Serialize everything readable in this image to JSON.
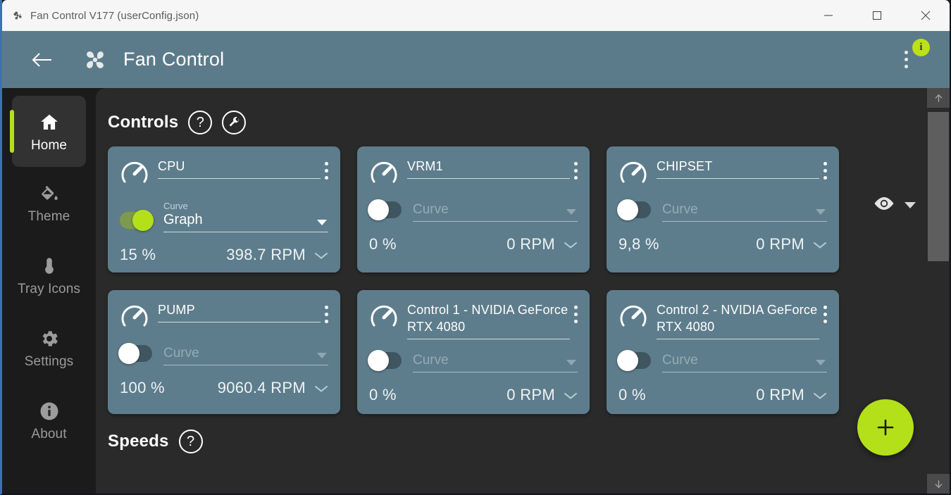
{
  "window": {
    "title": "Fan Control V177 (userConfig.json)",
    "icon": "fan-icon",
    "buttons": [
      {
        "name": "minimize",
        "label": "—"
      },
      {
        "name": "maximize",
        "label": "▢"
      },
      {
        "name": "close",
        "label": "✕"
      }
    ]
  },
  "appbar": {
    "back_label": "back-arrow",
    "logo": "fan-icon",
    "title": "Fan Control",
    "menu": "kebab-menu",
    "badge": "i"
  },
  "sidebar": {
    "items": [
      {
        "label": "Home",
        "icon": "home-icon",
        "active": true
      },
      {
        "label": "Theme",
        "icon": "paint-bucket-icon",
        "active": false
      },
      {
        "label": "Tray\nIcons",
        "icon": "thermometer-icon",
        "active": false
      },
      {
        "label": "Settings",
        "icon": "gear-icon",
        "active": false
      },
      {
        "label": "About",
        "icon": "info-circle-icon",
        "active": false
      }
    ]
  },
  "main": {
    "controls_section": {
      "title": "Controls",
      "help_icon": "?",
      "wrench_icon": "wrench-icon"
    },
    "visibility": {
      "eye_icon": "eye-icon",
      "caret": "chevron-down-icon"
    },
    "cards": [
      {
        "title": "CPU",
        "enabled": true,
        "curve_label": "Curve",
        "curve_value": "Graph",
        "curve_placeholder": "Curve",
        "percent": "15 %",
        "rpm": "398.7 RPM"
      },
      {
        "title": "VRM1",
        "enabled": false,
        "curve_label": "",
        "curve_value": "",
        "curve_placeholder": "Curve",
        "percent": "0 %",
        "rpm": "0 RPM"
      },
      {
        "title": "CHIPSET",
        "enabled": false,
        "curve_label": "",
        "curve_value": "",
        "curve_placeholder": "Curve",
        "percent": "9,8 %",
        "rpm": "0 RPM"
      },
      {
        "title": "PUMP",
        "enabled": false,
        "curve_label": "",
        "curve_value": "",
        "curve_placeholder": "Curve",
        "percent": "100 %",
        "rpm": "9060.4 RPM"
      },
      {
        "title": "Control 1 - NVIDIA GeForce RTX 4080",
        "enabled": false,
        "curve_label": "",
        "curve_value": "",
        "curve_placeholder": "Curve",
        "percent": "0 %",
        "rpm": "0 RPM"
      },
      {
        "title": "Control 2 - NVIDIA GeForce RTX 4080",
        "enabled": false,
        "curve_label": "",
        "curve_value": "",
        "curve_placeholder": "Curve",
        "percent": "0 %",
        "rpm": "0 RPM"
      }
    ],
    "speeds_section": {
      "title": "Speeds",
      "help_icon": "?"
    },
    "add_button": "+"
  },
  "colors": {
    "accent_green": "#b4e01a",
    "card_blue": "#5e7d8c",
    "appbar_blue": "#5c7b8a",
    "panel_bg": "#2a2a2a",
    "sidebar_bg": "#1b1b1b"
  }
}
